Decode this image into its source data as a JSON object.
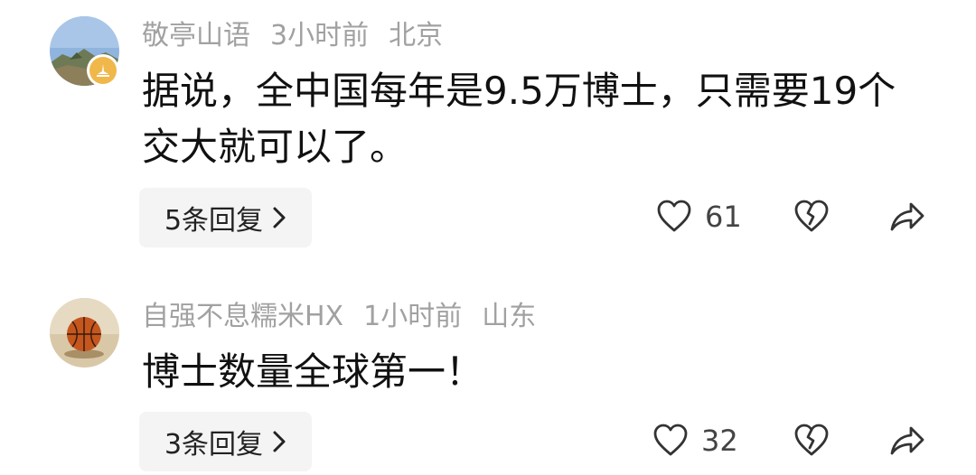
{
  "comments": [
    {
      "username": "敬亭山语",
      "time": "3小时前",
      "location": "北京",
      "text": "据说，全中国每年是9.5万博士，只需要19个交大就可以了。",
      "reply_label": "5条回复",
      "like_count": "61",
      "avatar": "mountain-landscape"
    },
    {
      "username": "自强不息糯米HX",
      "time": "1小时前",
      "location": "山东",
      "text": "博士数量全球第一！",
      "reply_label": "3条回复",
      "like_count": "32",
      "avatar": "basketball"
    }
  ],
  "icons": [
    "heart-icon",
    "broken-heart-icon",
    "share-icon",
    "chevron-right-icon",
    "verified-badge-icon"
  ],
  "colors": {
    "meta_text": "#a1a1a1",
    "body_text": "#111111",
    "reply_bg": "#f4f4f4",
    "badge": "#f0b84a"
  }
}
